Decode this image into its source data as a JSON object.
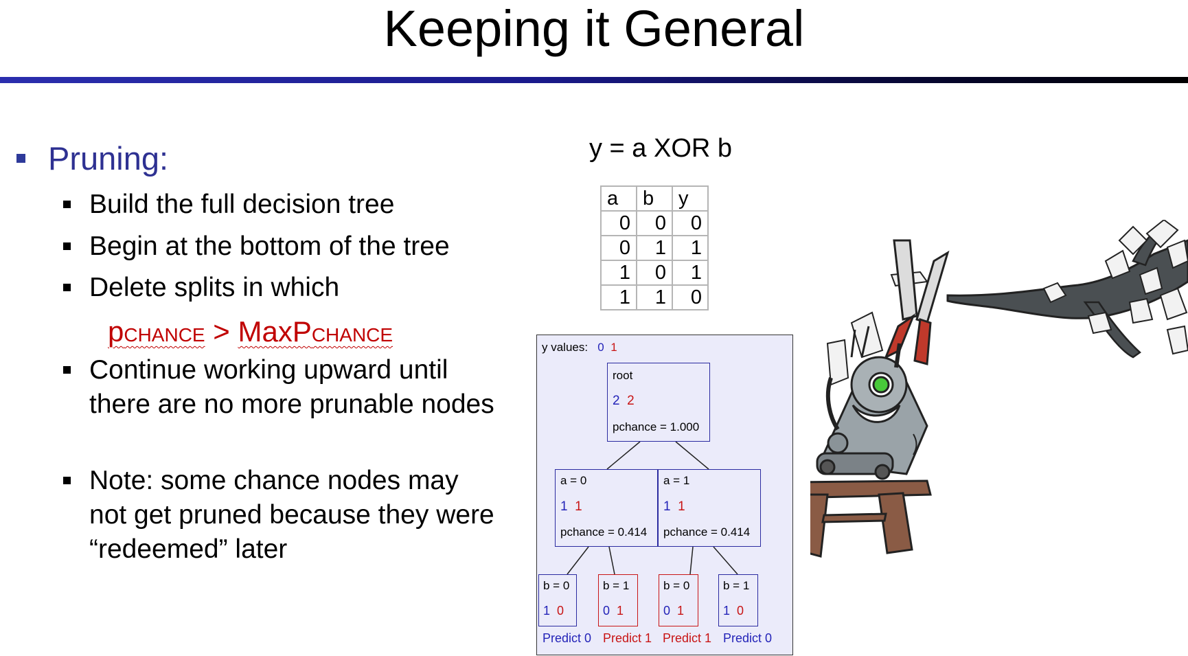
{
  "title": "Keeping it General",
  "pruning": {
    "heading": "Pruning:",
    "items": [
      "Build the full decision tree",
      "Begin at the bottom of the tree",
      "Delete splits in which",
      "Continue working upward until there are no more prunable nodes",
      "Note: some chance nodes may not get pruned because they were “redeemed” later"
    ],
    "formula": {
      "p": "p",
      "p_sub": "CHANCE",
      "op": " > ",
      "maxp": "MaxP",
      "maxp_sub": "CHANCE"
    }
  },
  "xor_title": "y = a XOR b",
  "truth_table": {
    "headers": [
      "a",
      "b",
      "y"
    ],
    "rows": [
      [
        "0",
        "0",
        "0"
      ],
      [
        "0",
        "1",
        "1"
      ],
      [
        "1",
        "0",
        "1"
      ],
      [
        "1",
        "1",
        "0"
      ]
    ]
  },
  "tree": {
    "legend_label": "y values:",
    "legend_zero": "0",
    "legend_one": "1",
    "root": {
      "label": "root",
      "c0": "2",
      "c1": "2",
      "pchance": "pchance = 1.000"
    },
    "a0": {
      "label": "a = 0",
      "c0": "1",
      "c1": "1",
      "pchance": "pchance = 0.414"
    },
    "a1": {
      "label": "a = 1",
      "c0": "1",
      "c1": "1",
      "pchance": "pchance = 0.414"
    },
    "leaves": [
      {
        "label": "b = 0",
        "c0": "1",
        "c1": "0",
        "predict": "Predict 0"
      },
      {
        "label": "b = 1",
        "c0": "0",
        "c1": "1",
        "predict": "Predict 1"
      },
      {
        "label": "b = 0",
        "c0": "0",
        "c1": "1",
        "predict": "Predict 1"
      },
      {
        "label": "b = 1",
        "c0": "1",
        "c1": "0",
        "predict": "Predict 0"
      }
    ]
  },
  "colors": {
    "heading": "#2e3192",
    "red": "#c00000",
    "tree_blue": "#2323b8",
    "tree_red": "#c81414",
    "panel": "#ebebfa"
  },
  "illustration": {
    "icon": "robot-pruning-tree-illustration"
  }
}
